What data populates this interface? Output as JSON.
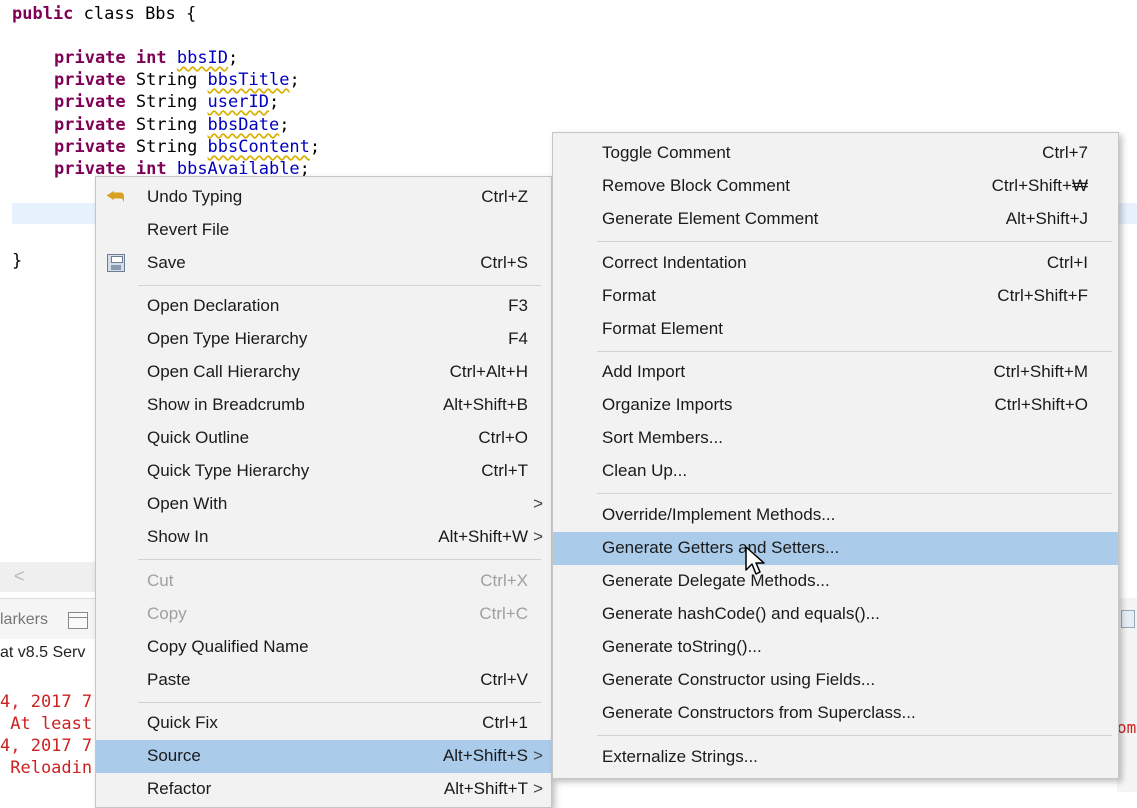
{
  "editor": {
    "code_lines": [
      {
        "kw": "public",
        "rest": " class Bbs {"
      },
      {
        "kw": "private",
        "type": " int ",
        "field": "bbsID",
        "end": ";"
      },
      {
        "kw": "private",
        "type": " String ",
        "field": "bbsTitle",
        "end": ";"
      },
      {
        "kw": "private",
        "type": " String ",
        "field": "userID",
        "end": ";"
      },
      {
        "kw": "private",
        "type": " String ",
        "field": "bbsDate",
        "end": ";"
      },
      {
        "kw": "private",
        "type": " String ",
        "field": "bbsContent",
        "end": ";"
      },
      {
        "kw": "private",
        "type": " int ",
        "field": "bbsAvailable",
        "end": ";"
      }
    ],
    "closing_brace": "}",
    "scroll_left": "<"
  },
  "bottom_panel": {
    "markers_tab": "larkers",
    "server_label": "at v8.5 Serv",
    "console_lines": [
      "4, 2017 7",
      " At least",
      "4, 2017 7",
      " Reloadin"
    ],
    "right_clip": "omp"
  },
  "context_menu": {
    "items": [
      {
        "label": "Undo Typing",
        "shortcut": "Ctrl+Z",
        "icon": "undo-icon"
      },
      {
        "label": "Revert File",
        "shortcut": ""
      },
      {
        "label": "Save",
        "shortcut": "Ctrl+S",
        "icon": "save-icon"
      },
      {
        "label": "Open Declaration",
        "shortcut": "F3"
      },
      {
        "label": "Open Type Hierarchy",
        "shortcut": "F4"
      },
      {
        "label": "Open Call Hierarchy",
        "shortcut": "Ctrl+Alt+H"
      },
      {
        "label": "Show in Breadcrumb",
        "shortcut": "Alt+Shift+B"
      },
      {
        "label": "Quick Outline",
        "shortcut": "Ctrl+O"
      },
      {
        "label": "Quick Type Hierarchy",
        "shortcut": "Ctrl+T"
      },
      {
        "label": "Open With",
        "shortcut": "",
        "submenu": ">"
      },
      {
        "label": "Show In",
        "shortcut": "Alt+Shift+W",
        "submenu": ">"
      },
      {
        "label": "Cut",
        "shortcut": "Ctrl+X",
        "disabled": true
      },
      {
        "label": "Copy",
        "shortcut": "Ctrl+C",
        "disabled": true
      },
      {
        "label": "Copy Qualified Name",
        "shortcut": ""
      },
      {
        "label": "Paste",
        "shortcut": "Ctrl+V"
      },
      {
        "label": "Quick Fix",
        "shortcut": "Ctrl+1"
      },
      {
        "label": "Source",
        "shortcut": "Alt+Shift+S",
        "submenu": ">",
        "highlighted": true
      },
      {
        "label": "Refactor",
        "shortcut": "Alt+Shift+T",
        "submenu": ">"
      }
    ]
  },
  "source_menu": {
    "items": [
      {
        "label": "Toggle Comment",
        "shortcut": "Ctrl+7"
      },
      {
        "label": "Remove Block Comment",
        "shortcut": "Ctrl+Shift+₩"
      },
      {
        "label": "Generate Element Comment",
        "shortcut": "Alt+Shift+J"
      },
      {
        "label": "Correct Indentation",
        "shortcut": "Ctrl+I"
      },
      {
        "label": "Format",
        "shortcut": "Ctrl+Shift+F"
      },
      {
        "label": "Format Element",
        "shortcut": ""
      },
      {
        "label": "Add Import",
        "shortcut": "Ctrl+Shift+M"
      },
      {
        "label": "Organize Imports",
        "shortcut": "Ctrl+Shift+O"
      },
      {
        "label": "Sort Members...",
        "shortcut": ""
      },
      {
        "label": "Clean Up...",
        "shortcut": ""
      },
      {
        "label": "Override/Implement Methods...",
        "shortcut": ""
      },
      {
        "label": "Generate Getters and Setters...",
        "shortcut": "",
        "highlighted": true
      },
      {
        "label": "Generate Delegate Methods...",
        "shortcut": ""
      },
      {
        "label": "Generate hashCode() and equals()...",
        "shortcut": ""
      },
      {
        "label": "Generate toString()...",
        "shortcut": ""
      },
      {
        "label": "Generate Constructor using Fields...",
        "shortcut": ""
      },
      {
        "label": "Generate Constructors from Superclass...",
        "shortcut": ""
      },
      {
        "label": "Externalize Strings...",
        "shortcut": ""
      }
    ]
  },
  "colors": {
    "keyword": "#7f0055",
    "field": "#0000c0",
    "highlight": "#aacbea",
    "menu_bg": "#f2f2f2",
    "console_error": "#cc2222"
  }
}
